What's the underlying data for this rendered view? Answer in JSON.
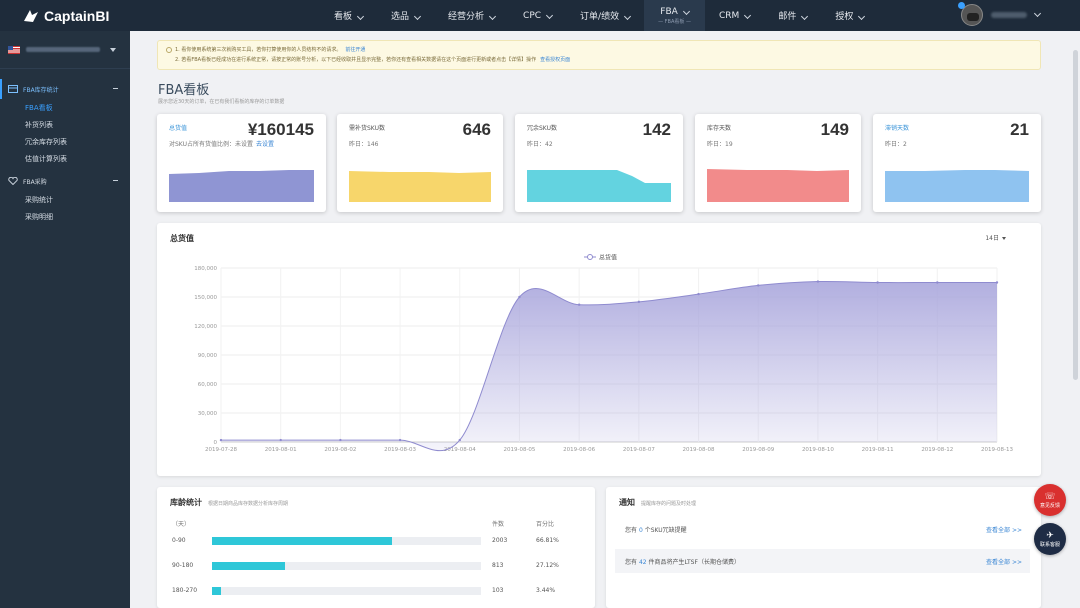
{
  "app": {
    "logo_text": "CaptainBI"
  },
  "nav": [
    {
      "label": "看板"
    },
    {
      "label": "选品"
    },
    {
      "label": "经营分析"
    },
    {
      "label": "CPC"
    },
    {
      "label": "订单/绩效"
    },
    {
      "label": "FBA",
      "sub": "— FBA看板 —"
    },
    {
      "label": "CRM"
    },
    {
      "label": "邮件"
    },
    {
      "label": "授权"
    }
  ],
  "sidebar": {
    "groups": [
      {
        "label": "FBA库存统计",
        "items": [
          "FBA看板",
          "补货列表",
          "冗余库存列表",
          "估值计算列表"
        ]
      },
      {
        "label": "FBA采购",
        "items": [
          "采购统计",
          "采购明细"
        ]
      }
    ]
  },
  "notice": {
    "line1": "1. 看你使用系统第三次就购买工具，若你打算使用你的人员结构不的请求。",
    "line1_link": "前往开通",
    "line2": "2. 若看FBA看板已经成功在进行系统正常，请按正常的账号分析，以下已经收取并且显示完整，若你还有查看相关数据请在这个页面进行更新或者点击【详情】操作",
    "line2_link": "查看授权页面"
  },
  "page": {
    "title": "FBA看板",
    "desc": "展示您近30天的订单，在已有我们看板的库存的订单数据"
  },
  "kpis": [
    {
      "label": "总货值",
      "value": "¥160145",
      "sub": "对SKU占所有货值比例：未设置",
      "sub_link": "去设置",
      "color": "#8f95d3"
    },
    {
      "label": "需补货SKU数",
      "value": "646",
      "sub": "昨日：146",
      "color": "#f7d66b"
    },
    {
      "label": "冗余SKU数",
      "value": "142",
      "sub": "昨日：42",
      "color": "#63d3e0"
    },
    {
      "label": "库存天数",
      "value": "149",
      "sub": "昨日：19",
      "color": "#f28b8b"
    },
    {
      "label": "滞销天数",
      "value": "21",
      "sub": "昨日：2",
      "color": "#8fc3f0"
    }
  ],
  "main_chart": {
    "title": "总货值",
    "range": "14日",
    "legend": "总货值",
    "colors": {
      "fill": "#a9a6dc",
      "line": "#8f8bcf"
    }
  },
  "chart_data": {
    "type": "area",
    "title": "总货值",
    "x": [
      "2019-07-28",
      "2019-08-01",
      "2019-08-02",
      "2019-08-03",
      "2019-08-04",
      "2019-08-05",
      "2019-08-06",
      "2019-08-07",
      "2019-08-08",
      "2019-08-09",
      "2019-08-10",
      "2019-08-11",
      "2019-08-12",
      "2019-08-13"
    ],
    "yticks": [
      "0",
      "30,000",
      "60,000",
      "90,000",
      "120,000",
      "150,000",
      "180,000"
    ],
    "ylim": [
      0,
      180000
    ],
    "series": [
      {
        "name": "总货值",
        "values": [
          2000,
          2000,
          2000,
          2000,
          2000,
          150000,
          142000,
          145000,
          153000,
          162000,
          166000,
          165000,
          165000,
          165000
        ]
      }
    ],
    "legend_position": "top-center"
  },
  "stock_age": {
    "title": "库龄统计",
    "desc": "根据日期商品库存数据分析库存周期",
    "unit_header": "（天）",
    "count_header": "件数",
    "pct_header": "百分比",
    "rows": [
      {
        "label": "0-90",
        "count": "2003",
        "pct": "66.81%",
        "ratio": 0.6681
      },
      {
        "label": "90-180",
        "count": "813",
        "pct": "27.12%",
        "ratio": 0.2712
      },
      {
        "label": "180-270",
        "count": "103",
        "pct": "3.44%",
        "ratio": 0.0344
      }
    ]
  },
  "notify": {
    "title": "通知",
    "desc": "提醒库存的问题及时处理",
    "rows": [
      {
        "pre": "您有",
        "num": "0",
        "post": "个SKU冗缺提醒",
        "more": "查看全部 >>"
      },
      {
        "pre": "您有",
        "num": "42",
        "post": "件商品将产生LTSF（长期仓储费）",
        "more": "查看全部 >>"
      }
    ]
  },
  "floats": [
    {
      "glyph": "☏",
      "label": "意见反馈"
    },
    {
      "glyph": "✈",
      "label": "联系客服"
    }
  ]
}
